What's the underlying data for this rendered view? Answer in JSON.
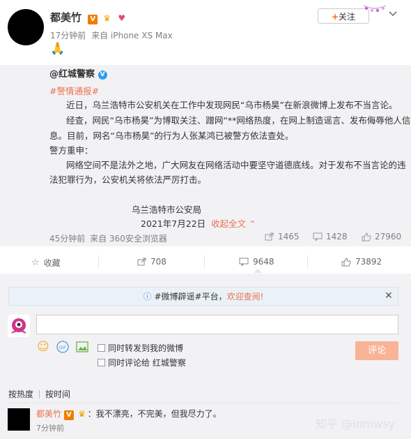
{
  "post": {
    "username": "都美竹",
    "verified_badge": "V",
    "time": "17分钟前",
    "source": "来自 iPhone XS Max",
    "emoji": "🙏",
    "follow_label": "关注"
  },
  "repost": {
    "user": "@红城警察",
    "hashtag": "#警情通报#",
    "lines": [
      "近日，乌兰浩特市公安机关在工作中发现网民“乌市杨昊”在新浪微博上发布不当言论。",
      "经查，网民“乌市杨昊”为博取关注、蹭网“**网络热度，在网上制造谣言、发布侮辱他人信",
      "息。目前，网名“乌市杨昊”的行为人张某鸿已被警方依法查处。",
      "警方重申：",
      "网络空间不是法外之地，广大网友在网络活动中要坚守道德底线。对于发布不当言论的违",
      "法犯罪行为，公安机关将依法严厉打击。"
    ],
    "signature": "乌兰浩特市公安局",
    "date": "2021年7月22日",
    "collapse_label": "收起全文",
    "time": "45分钟前",
    "source": "来自 360安全浏览器",
    "reposts": "1465",
    "comments": "1428",
    "likes": "27960"
  },
  "actions": {
    "favorite": "收藏",
    "repost": "708",
    "comment": "9648",
    "like": "73892"
  },
  "comment_box": {
    "notice_prefix": "#微博辟谣#平台，",
    "notice_link": "欢迎查阅!",
    "input_value": "",
    "repost_option": "同时转发到我的微博",
    "comment_option": "同时评论给 红城警察",
    "submit_label": "评论",
    "sort_hot": "按热度",
    "sort_time": "按时间"
  },
  "comments": [
    {
      "user": "都美竹",
      "text": "：我不漂亮，不完美，但我尽力了。",
      "time": "7分钟前"
    }
  ],
  "watermark": "知乎 @inmwsy",
  "colors": {
    "accent": "#eb7350",
    "verified_orange": "#f07d00",
    "verified_blue": "#2d9ef0",
    "gray_bg": "#f2f2f5",
    "submit_disabled": "#f9b397"
  }
}
